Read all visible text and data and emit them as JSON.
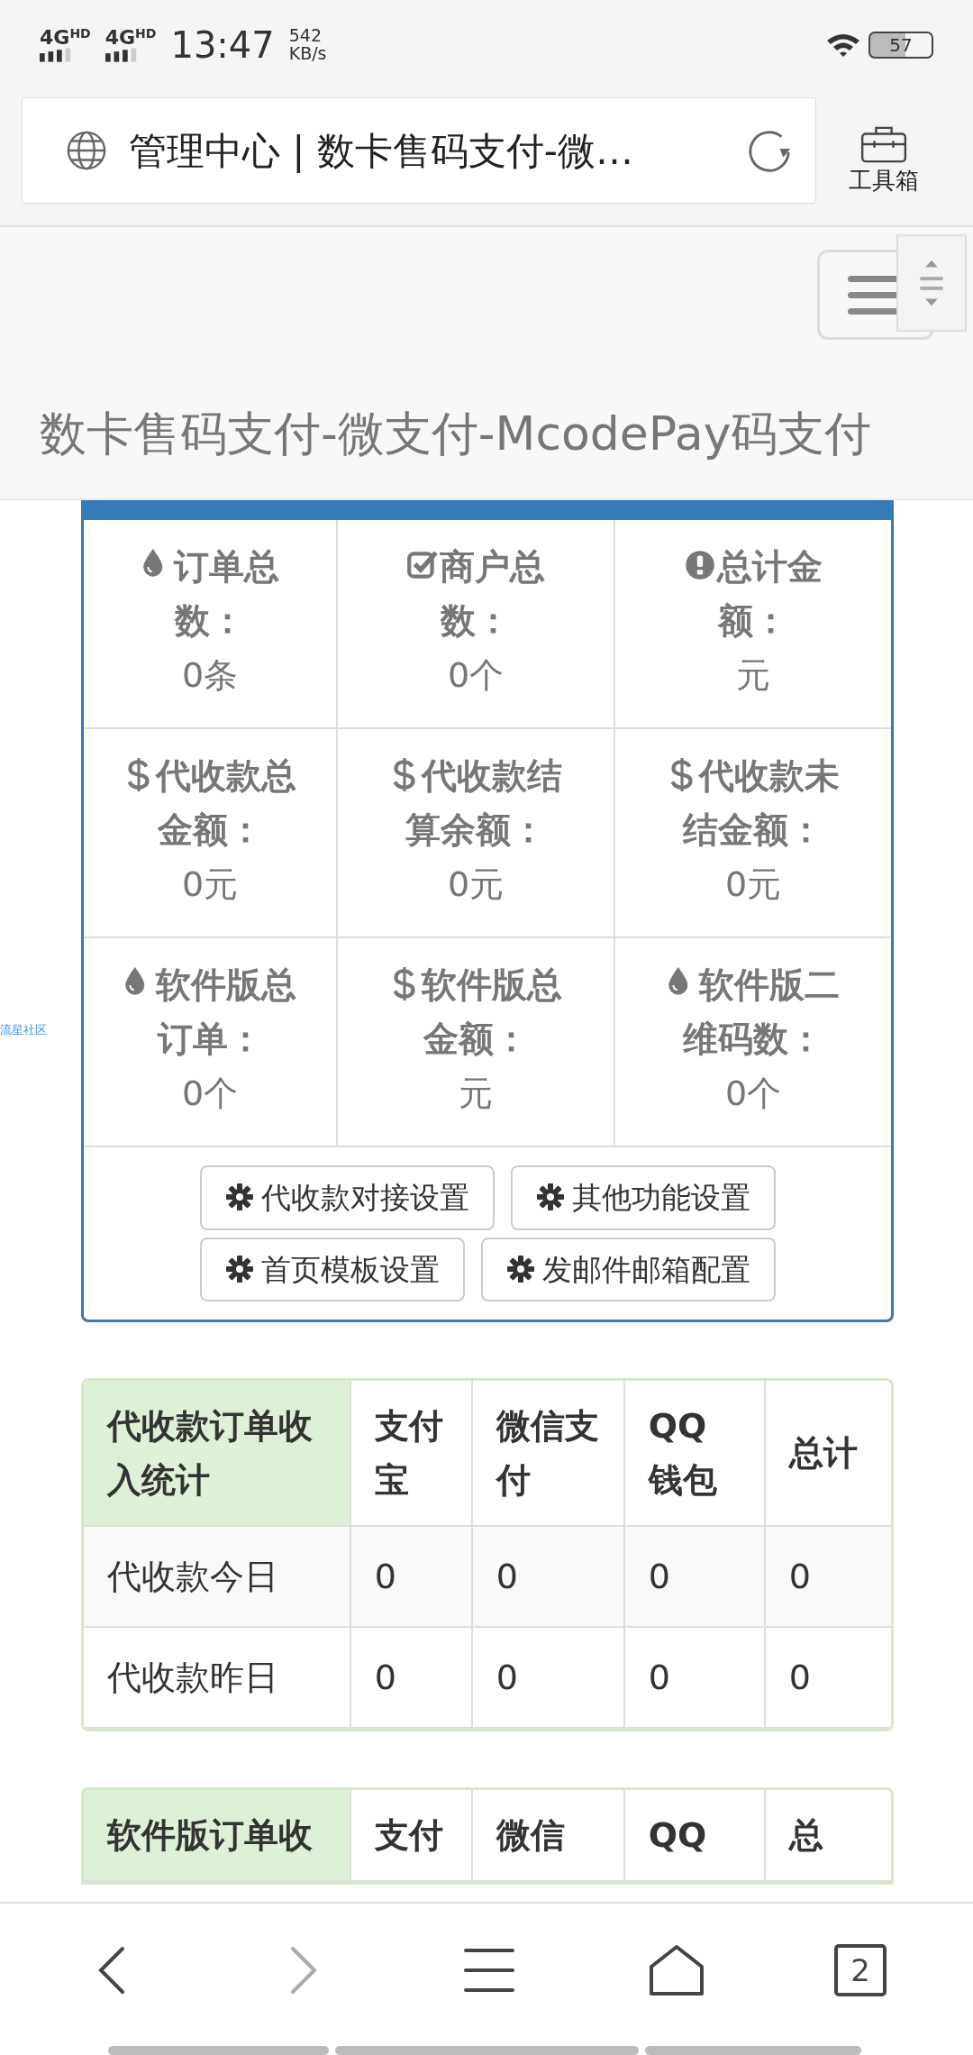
{
  "status_bar": {
    "signals": [
      "4G$^{HD}$",
      "4G$^{HD}$"
    ],
    "time": "13:47",
    "speed": "542",
    "speed_unit": "KB/s",
    "battery": "57"
  },
  "browser": {
    "address": "管理中心 | 数卡售码支付-微…",
    "toolbox_label": "工具箱"
  },
  "header": {
    "title": "数卡售码支付-微支付-McodePay码支付"
  },
  "side_text": "流星社区",
  "stats": [
    {
      "kind": "drop",
      "label": "订单总数：",
      "value": "0条"
    },
    {
      "kind": "check",
      "label": "商户总数：",
      "value": "0个"
    },
    {
      "kind": "alert",
      "label": "总计金额：",
      "value": "元"
    },
    {
      "kind": "dollar",
      "label": "代收款总金额：",
      "value": "0元"
    },
    {
      "kind": "dollar",
      "label": "代收款结算余额：",
      "value": "0元"
    },
    {
      "kind": "dollar",
      "label": "代收款未结金额：",
      "value": "0元"
    },
    {
      "kind": "drop",
      "label": "软件版总订单：",
      "value": "0个"
    },
    {
      "kind": "dollar",
      "label": "软件版总金额：",
      "value": "元"
    },
    {
      "kind": "drop",
      "label": "软件版二维码数：",
      "value": "0个"
    }
  ],
  "settings_buttons": [
    "代收款对接设置",
    "其他功能设置",
    "首页模板设置",
    "发邮件邮箱配置"
  ],
  "income_table": {
    "columns": [
      "代收款订单收入统计",
      "支付宝",
      "微信支付",
      "QQ钱包",
      "总计"
    ],
    "rows": [
      [
        "代收款今日",
        "0",
        "0",
        "0",
        "0"
      ],
      [
        "代收款昨日",
        "0",
        "0",
        "0",
        "0"
      ]
    ]
  },
  "software_table": {
    "columns": [
      "软件版订单收",
      "支付",
      "微信",
      "QQ",
      "总"
    ]
  },
  "bottom_nav": {
    "back_disabled": false,
    "forward_disabled": true,
    "tab_count": "2"
  }
}
